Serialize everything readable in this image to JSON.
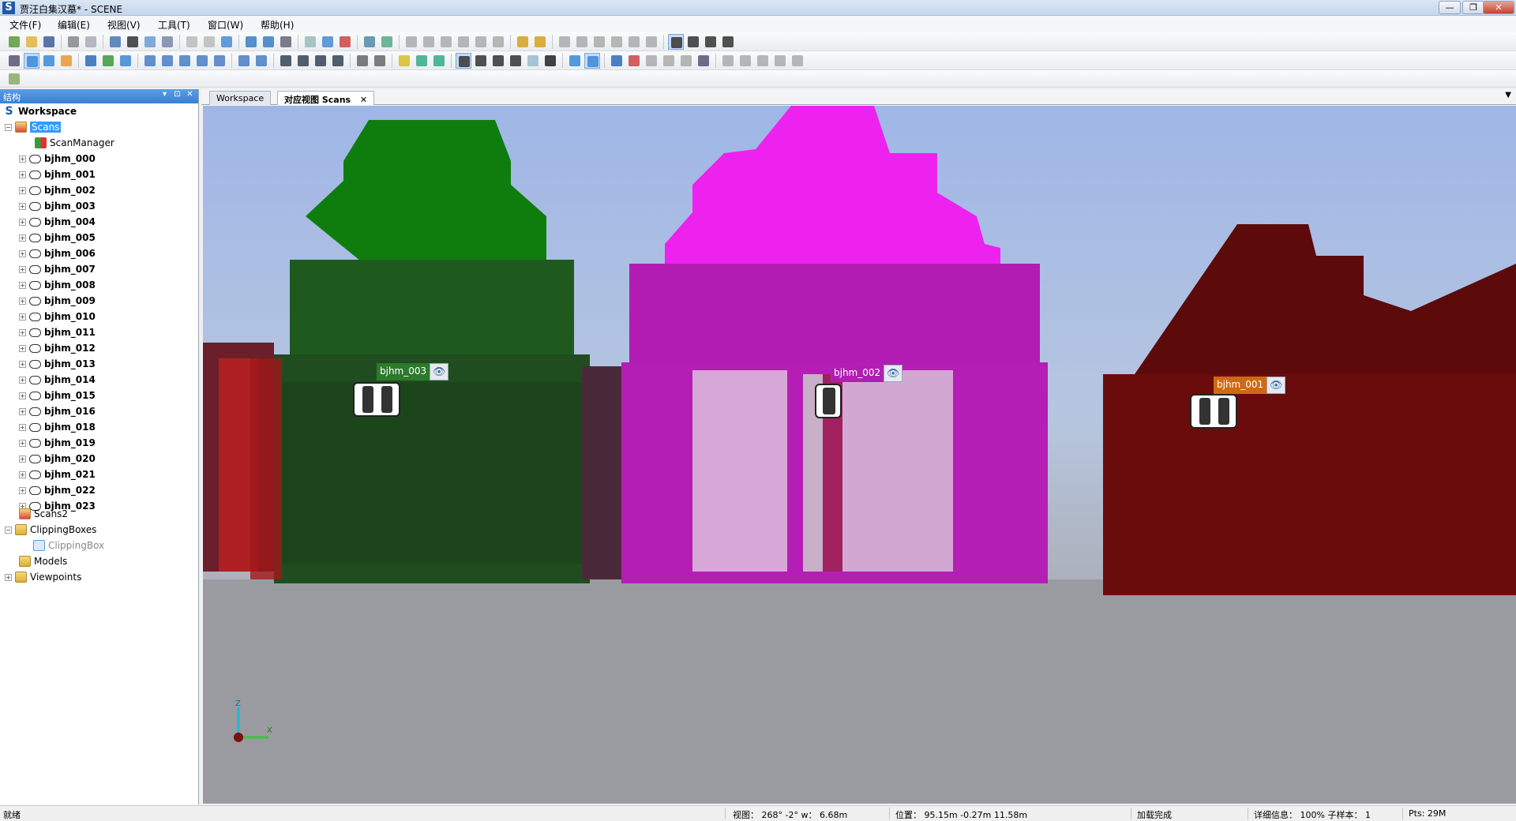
{
  "window": {
    "title": "贾汪白集汉墓* - SCENE",
    "app_letter": "S",
    "min": "—",
    "max": "❐",
    "close": "✕"
  },
  "menu": [
    "文件(F)",
    "编辑(E)",
    "视图(V)",
    "工具(T)",
    "窗口(W)",
    "帮助(H)"
  ],
  "panel": {
    "title": "结构",
    "pin": "▾ ⊡ ✕"
  },
  "tree": {
    "workspace": "Workspace",
    "scans": "Scans",
    "scan_manager": "ScanManager",
    "scan_items": [
      "bjhm_000",
      "bjhm_001",
      "bjhm_002",
      "bjhm_003",
      "bjhm_004",
      "bjhm_005",
      "bjhm_006",
      "bjhm_007",
      "bjhm_008",
      "bjhm_009",
      "bjhm_010",
      "bjhm_011",
      "bjhm_012",
      "bjhm_013",
      "bjhm_014",
      "bjhm_015",
      "bjhm_016",
      "bjhm_018",
      "bjhm_019",
      "bjhm_020",
      "bjhm_021",
      "bjhm_022",
      "bjhm_023"
    ],
    "scans2": "Scans2",
    "clipping_boxes": "ClippingBoxes",
    "clipping_box": "ClippingBox",
    "models": "Models",
    "viewpoints": "Viewpoints"
  },
  "tabs": [
    "Workspace",
    "对应视图 Scans"
  ],
  "tab_close": "✕",
  "viewport": {
    "tags": [
      {
        "label": "bjhm_003",
        "color": "#2c7a2c"
      },
      {
        "label": "bjhm_002",
        "color": "#b01fb0"
      },
      {
        "label": "bjhm_001",
        "color": "#d06a10"
      }
    ],
    "eye_icon": "👁",
    "axis": {
      "z": "Z",
      "x": "X"
    }
  },
  "status": {
    "ready": "就绪",
    "view": "视图： 268° -2° w： 6.68m",
    "position": "位置： 95.15m -0.27m 11.58m",
    "load": "加载完成",
    "detail": "详细信息： 100%  子样本： 1",
    "points": "Pts: 29M"
  },
  "colors": {
    "green_scan": "#0e7a0e",
    "magenta_scan": "#d91fd9",
    "maroon_scan": "#6a0a0a",
    "selection": "#3399ff"
  }
}
